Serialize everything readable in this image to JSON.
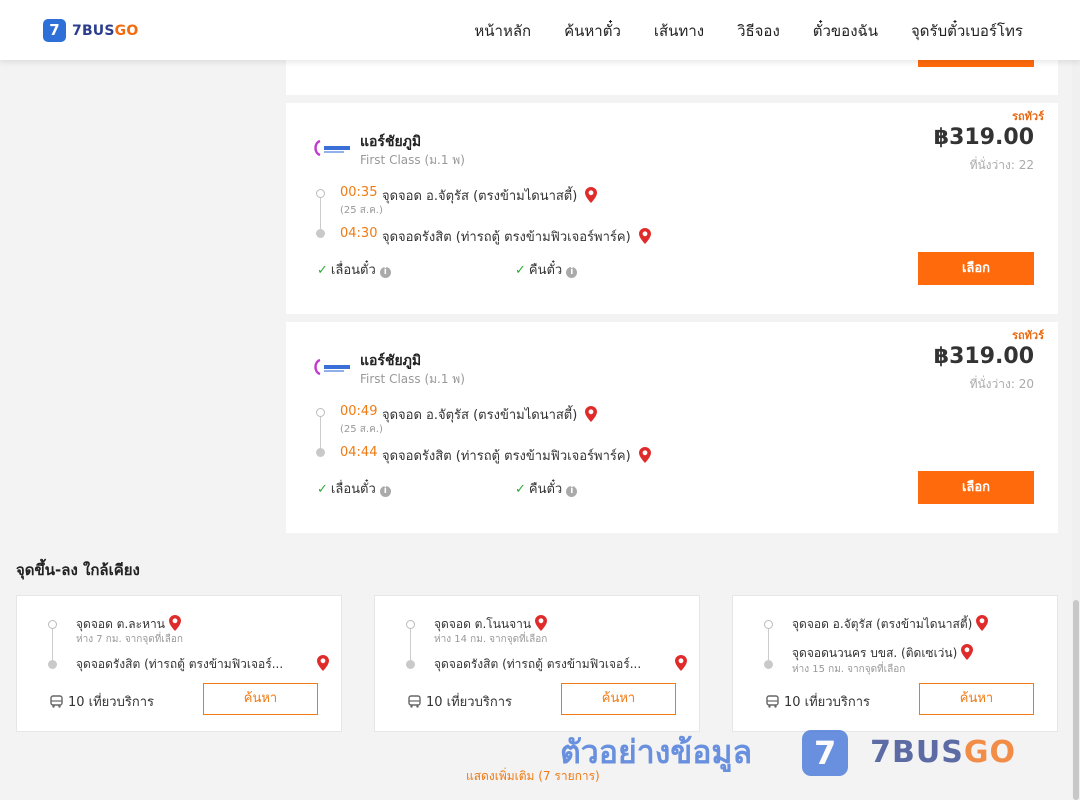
{
  "header": {
    "logo_text": "7BUS",
    "logo_text_go": "GO",
    "logo_mark": "7",
    "nav": [
      "หน้าหลัก",
      "ค้นหาตั๋ว",
      "เส้นทาง",
      "วิธีจอง",
      "ตั๋วของฉัน",
      "จุดรับตั๋วเบอร์โทร"
    ]
  },
  "results": [
    {
      "badge": "รถทัวร์",
      "operator": "แอร์ชัยภูมิ",
      "class": "First Class (ม.1 พ)",
      "price": "฿319.00",
      "seats": "ที่นั่งว่าง: 22",
      "depart_time": "00:35",
      "depart_stop": "จุดจอด อ.จัตุรัส (ตรงข้ามไดนาสตี้)",
      "date_note": "(25 ส.ค.)",
      "arrive_time": "04:30",
      "arrive_stop": "จุดจอดรังสิต (ท่ารถตู้ ตรงข้ามฟิวเจอร์พาร์ค)",
      "feature1": "เลื่อนตั๋ว",
      "feature2": "คืนตั๋ว",
      "button": "เลือก"
    },
    {
      "badge": "รถทัวร์",
      "operator": "แอร์ชัยภูมิ",
      "class": "First Class (ม.1 พ)",
      "price": "฿319.00",
      "seats": "ที่นั่งว่าง: 20",
      "depart_time": "00:49",
      "depart_stop": "จุดจอด อ.จัตุรัส (ตรงข้ามไดนาสตี้)",
      "date_note": "(25 ส.ค.)",
      "arrive_time": "04:44",
      "arrive_stop": "จุดจอดรังสิต (ท่ารถตู้ ตรงข้ามฟิวเจอร์พาร์ค)",
      "feature1": "เลื่อนตั๋ว",
      "feature2": "คืนตั๋ว",
      "button": "เลือก"
    }
  ],
  "nearby": {
    "title": "จุดขึ้น-ลง ใกล้เคียง",
    "cards": [
      {
        "from": "จุดจอด ต.ละหาน",
        "from_sub": "ห่าง 7 กม. จากจุดที่เลือก",
        "to": "จุดจอดรังสิต (ท่ารถตู้ ตรงข้ามฟิวเจอร์...",
        "to_sub": "",
        "trips": "10 เที่ยวบริการ",
        "button": "ค้นหา"
      },
      {
        "from": "จุดจอด ต.โนนจาน",
        "from_sub": "ห่าง 14 กม. จากจุดที่เลือก",
        "to": "จุดจอดรังสิต (ท่ารถตู้ ตรงข้ามฟิวเจอร์...",
        "to_sub": "",
        "trips": "10 เที่ยวบริการ",
        "button": "ค้นหา"
      },
      {
        "from": "จุดจอด อ.จัตุรัส (ตรงข้ามไดนาสตี้)",
        "from_sub": "",
        "to": "จุดจอดนวนคร บขส. (ติดเซเว่น)",
        "to_sub": "ห่าง 15 กม. จากจุดที่เลือก",
        "trips": "10 เที่ยวบริการ",
        "button": "ค้นหา"
      }
    ]
  },
  "show_more": "แสดงเพิ่มเติม (7 รายการ)",
  "watermark": {
    "text": "ตัวอย่างข้อมูล",
    "mark": "7",
    "brand": "7BUS",
    "brand_go": "GO"
  },
  "icons": {
    "pin": "map-pin-icon",
    "check": "check-icon",
    "info": "info-icon",
    "bus": "bus-icon"
  },
  "colors": {
    "accent": "#ff6a0c",
    "time": "#f07a13",
    "check": "#2eaa3c",
    "pin": "#e02b2b",
    "brand_blue": "#2f6fd8"
  }
}
